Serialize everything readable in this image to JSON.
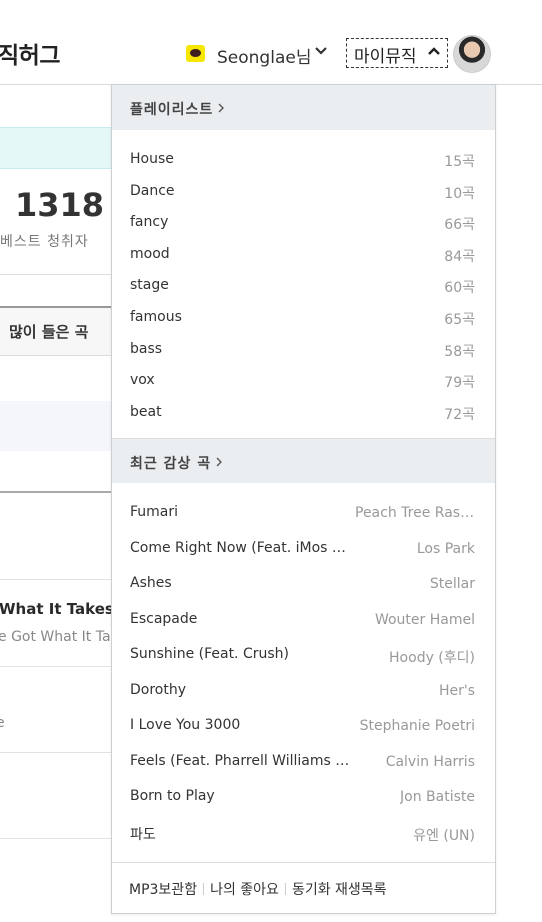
{
  "header": {
    "logo_text": "직허그",
    "user_name": "Seonglae님",
    "user_chevron": "⌄",
    "mymusic_label": "마이뮤직",
    "mymusic_chevron": "^"
  },
  "background": {
    "listener_count": "1318",
    "listener_label": "베스트 청취자",
    "tab_label": "많이 들은 곡",
    "song_title": "What It Takes)",
    "song_subtitle": "e Got What It Ta",
    "fragment": "e"
  },
  "dropdown": {
    "playlists_title": "플레이리스트",
    "section_chevron": ">",
    "playlists": [
      {
        "name": "House",
        "count": "15곡"
      },
      {
        "name": "Dance",
        "count": "10곡"
      },
      {
        "name": "fancy",
        "count": "66곡"
      },
      {
        "name": "mood",
        "count": "84곡"
      },
      {
        "name": "stage",
        "count": "60곡"
      },
      {
        "name": "famous",
        "count": "65곡"
      },
      {
        "name": "bass",
        "count": "58곡"
      },
      {
        "name": "vox",
        "count": "79곡"
      },
      {
        "name": "beat",
        "count": "72곡"
      }
    ],
    "recent_title": "최근 감상 곡",
    "recent": [
      {
        "title": "Fumari",
        "artist": "Peach Tree Rascals"
      },
      {
        "title": "Come Right Now (Feat. iMos & Kid Milli)",
        "artist": "Los Park"
      },
      {
        "title": "Ashes",
        "artist": "Stellar"
      },
      {
        "title": "Escapade",
        "artist": "Wouter Hamel"
      },
      {
        "title": "Sunshine (Feat. Crush)",
        "artist": "Hoody (후디)"
      },
      {
        "title": "Dorothy",
        "artist": "Her's"
      },
      {
        "title": "I Love You 3000",
        "artist": "Stephanie Poetri"
      },
      {
        "title": "Feels (Feat. Pharrell Williams & Katy Perry & Big Sean)",
        "artist": "Calvin Harris"
      },
      {
        "title": "Born to Play",
        "artist": "Jon Batiste"
      },
      {
        "title": "파도",
        "artist": "유엔 (UN)"
      }
    ],
    "footer_links": [
      "MP3보관함",
      "나의 좋아요",
      "동기화 재생목록"
    ]
  },
  "colors": {
    "section_header_bg": "#ebeef1",
    "band_bg": "#e4f8f8",
    "kakao_yellow": "#f7e600"
  }
}
